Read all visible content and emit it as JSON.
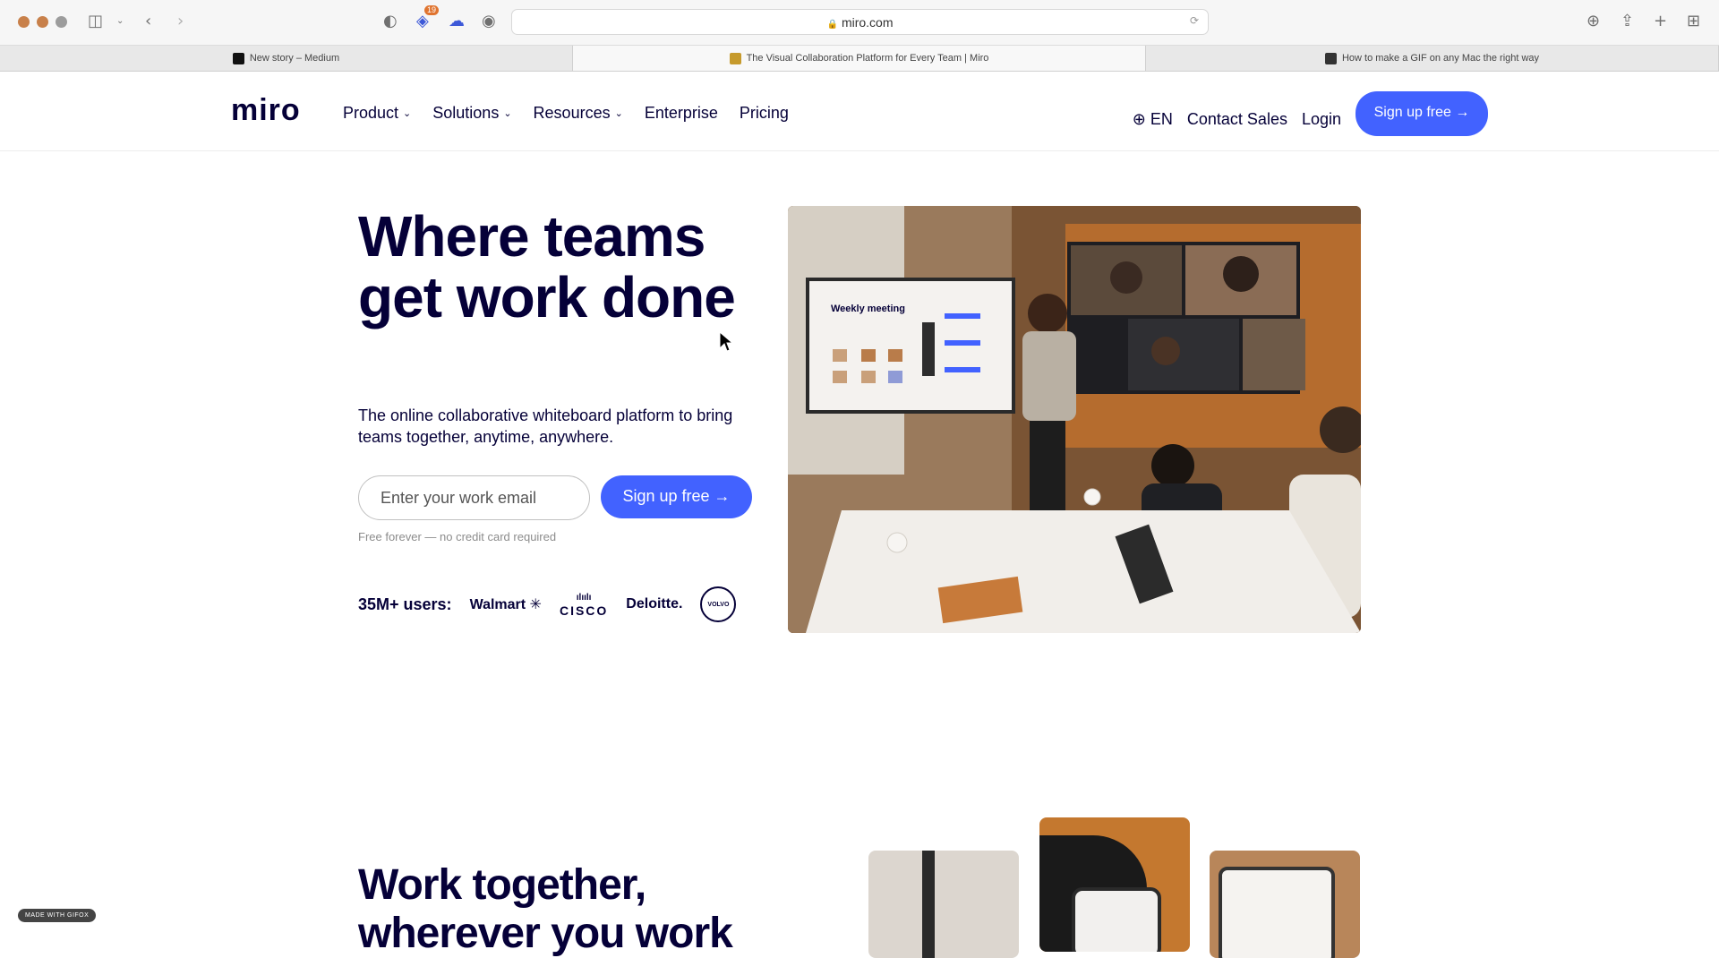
{
  "browser": {
    "url": "miro.com",
    "extension_badge": "19",
    "tabs": [
      {
        "title": "New story – Medium",
        "favicon_color": "#111111",
        "active": false
      },
      {
        "title": "The Visual Collaboration Platform for Every Team | Miro",
        "favicon_color": "#c69a2c",
        "active": true
      },
      {
        "title": "How to make a GIF on any Mac the right way",
        "favicon_color": "#333333",
        "active": false
      }
    ],
    "icons": [
      "sidebar-icon",
      "back-icon",
      "forward-icon",
      "shield-icon",
      "download-icon",
      "share-icon",
      "new-tab-icon",
      "tab-overview-icon"
    ]
  },
  "nav": {
    "logo": "miro",
    "links": [
      {
        "label": "Product",
        "dropdown": true
      },
      {
        "label": "Solutions",
        "dropdown": true
      },
      {
        "label": "Resources",
        "dropdown": true
      },
      {
        "label": "Enterprise",
        "dropdown": false
      },
      {
        "label": "Pricing",
        "dropdown": false
      }
    ],
    "language": "EN",
    "contact_sales": "Contact Sales",
    "login": "Login",
    "signup": "Sign up free →"
  },
  "hero": {
    "title": "Where teams get work done",
    "subtitle": "The online collaborative whiteboard platform to bring teams together, anytime, anywhere.",
    "email_placeholder": "Enter your work email",
    "cta": "Sign up free →",
    "note": "Free forever — no credit card required",
    "users_label": "35M+ users:",
    "brands": [
      "Walmart",
      "CISCO",
      "Deloitte.",
      "VOLVO"
    ],
    "screen_text": "Weekly meeting"
  },
  "section2": {
    "title": "Work together, wherever you work"
  },
  "watermark": "MADE WITH GIFOX",
  "colors": {
    "accent": "#4262ff",
    "text": "#050038",
    "traffic_close": "#c8804a",
    "traffic_min": "#c8804a",
    "traffic_max": "#9c9c9c"
  }
}
